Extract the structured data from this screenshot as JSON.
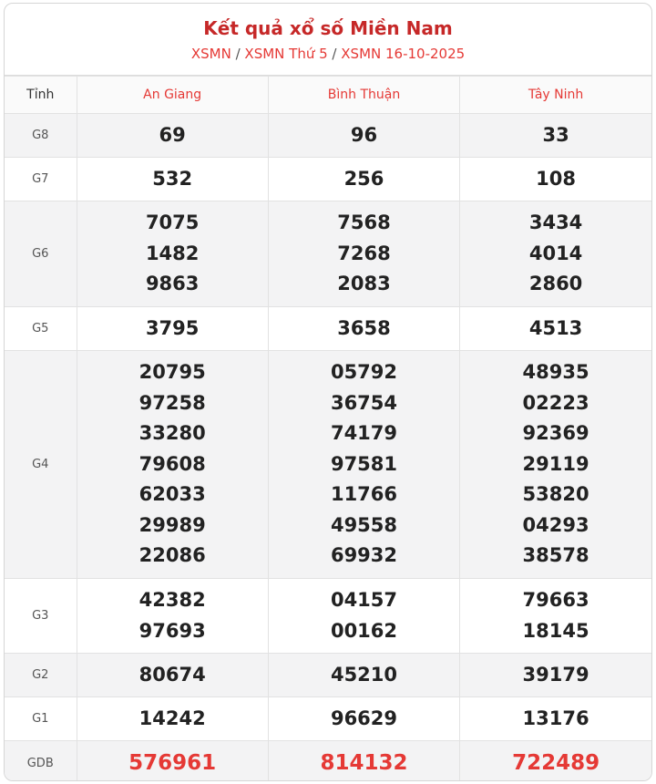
{
  "header": {
    "title": "Kết quả xổ số Miền Nam",
    "breadcrumb": [
      "XSMN",
      "XSMN Thứ 5",
      "XSMN 16-10-2025"
    ],
    "separator": "/"
  },
  "table": {
    "label_header": "Tỉnh",
    "provinces": [
      "An Giang",
      "Bình Thuận",
      "Tây Ninh"
    ],
    "rows": [
      {
        "label": "G8",
        "values": [
          [
            "69"
          ],
          [
            "96"
          ],
          [
            "33"
          ]
        ]
      },
      {
        "label": "G7",
        "values": [
          [
            "532"
          ],
          [
            "256"
          ],
          [
            "108"
          ]
        ]
      },
      {
        "label": "G6",
        "values": [
          [
            "7075",
            "1482",
            "9863"
          ],
          [
            "7568",
            "7268",
            "2083"
          ],
          [
            "3434",
            "4014",
            "2860"
          ]
        ]
      },
      {
        "label": "G5",
        "values": [
          [
            "3795"
          ],
          [
            "3658"
          ],
          [
            "4513"
          ]
        ]
      },
      {
        "label": "G4",
        "values": [
          [
            "20795",
            "97258",
            "33280",
            "79608",
            "62033",
            "29989",
            "22086"
          ],
          [
            "05792",
            "36754",
            "74179",
            "97581",
            "11766",
            "49558",
            "69932"
          ],
          [
            "48935",
            "02223",
            "92369",
            "29119",
            "53820",
            "04293",
            "38578"
          ]
        ]
      },
      {
        "label": "G3",
        "values": [
          [
            "42382",
            "97693"
          ],
          [
            "04157",
            "00162"
          ],
          [
            "79663",
            "18145"
          ]
        ]
      },
      {
        "label": "G2",
        "values": [
          [
            "80674"
          ],
          [
            "45210"
          ],
          [
            "39179"
          ]
        ]
      },
      {
        "label": "G1",
        "values": [
          [
            "14242"
          ],
          [
            "96629"
          ],
          [
            "13176"
          ]
        ]
      },
      {
        "label": "GDB",
        "values": [
          [
            "576961"
          ],
          [
            "814132"
          ],
          [
            "722489"
          ]
        ]
      }
    ]
  },
  "colors": {
    "accent": "#e53935",
    "title": "#c62828",
    "shade": "#f3f3f4"
  }
}
